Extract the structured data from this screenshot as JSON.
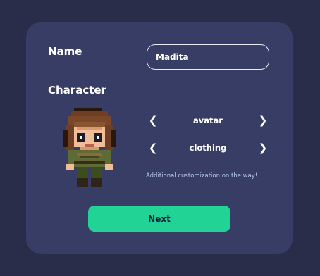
{
  "form": {
    "name_label": "Name",
    "name_value": "Madita",
    "character_label": "Character"
  },
  "character": {
    "options": [
      {
        "label": "avatar",
        "prev_icon": "chevron-left-icon",
        "next_icon": "chevron-right-icon"
      },
      {
        "label": "clothing",
        "prev_icon": "chevron-left-icon",
        "next_icon": "chevron-right-icon"
      }
    ],
    "note": "Additional customization on the way!",
    "avatar_icon": "pixel-character-icon"
  },
  "actions": {
    "next_label": "Next"
  },
  "colors": {
    "background": "#2a2d49",
    "card": "#383d66",
    "accent": "#22d396",
    "note_text": "#b5c8f0"
  }
}
